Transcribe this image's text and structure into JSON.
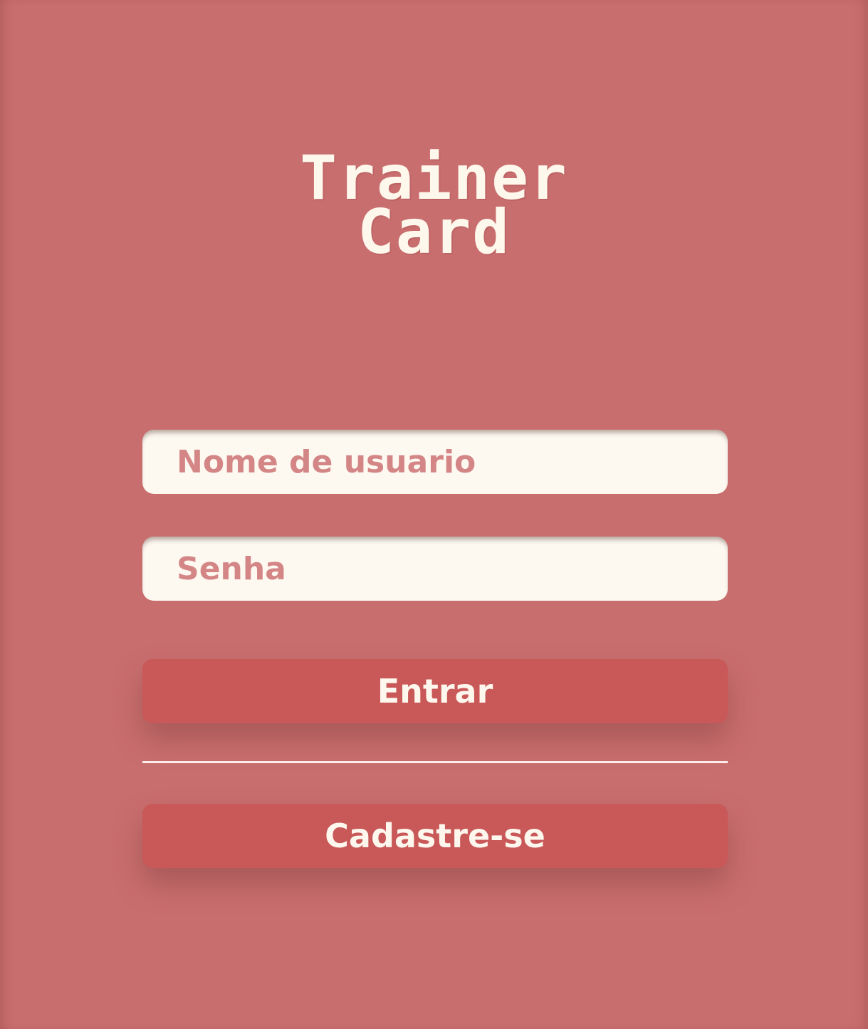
{
  "app": {
    "title_line1": "Trainer",
    "title_line2": "Card"
  },
  "form": {
    "username_placeholder": "Nome de usuario",
    "password_placeholder": "Senha",
    "login_label": "Entrar",
    "signup_label": "Cadastre-se"
  },
  "colors": {
    "background": "#c96e6e",
    "button": "#c95858",
    "input_background": "#fdf9f1",
    "placeholder": "#d48686",
    "logo_text": "#fdf7ec"
  }
}
